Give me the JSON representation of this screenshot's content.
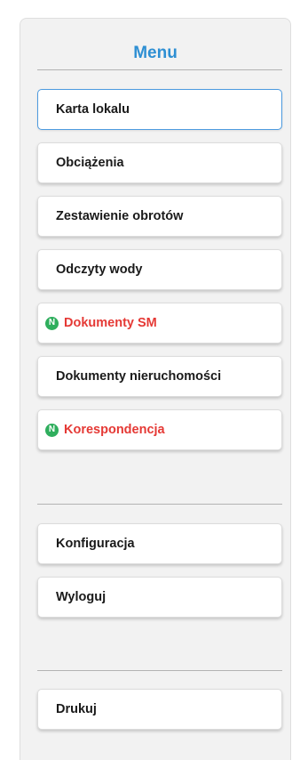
{
  "menu": {
    "title": "Menu",
    "items": [
      {
        "label": "Karta lokalu"
      },
      {
        "label": "Obciążenia"
      },
      {
        "label": "Zestawienie obrotów"
      },
      {
        "label": "Odczyty wody"
      },
      {
        "label": "Dokumenty SM",
        "badge": "N"
      },
      {
        "label": "Dokumenty nieruchomości"
      },
      {
        "label": "Korespondencja",
        "badge": "N"
      }
    ],
    "settings_items": [
      {
        "label": "Konfiguracja"
      },
      {
        "label": "Wyloguj"
      }
    ],
    "print_items": [
      {
        "label": "Drukuj"
      }
    ]
  },
  "colors": {
    "title": "#2e8fd3",
    "alert_text": "#e53935",
    "badge": "#2fae5d",
    "active_border": "#4d9be0"
  },
  "icons": {
    "new_badge": "new-badge-icon"
  }
}
